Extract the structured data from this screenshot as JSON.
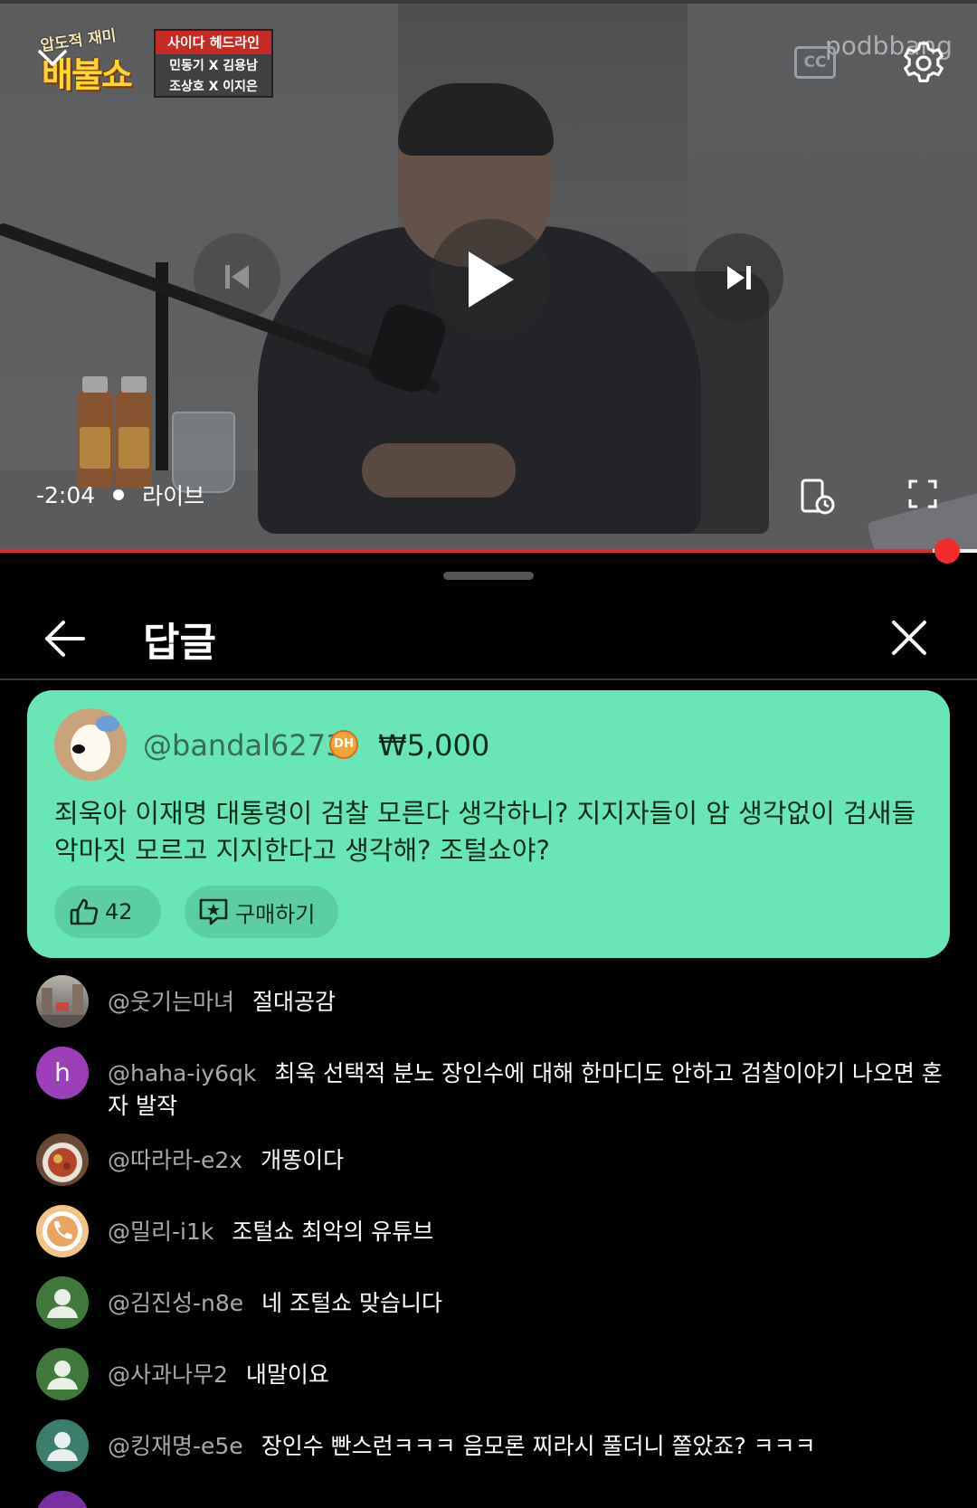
{
  "player": {
    "show_logo_tag": "압도적 재미",
    "show_logo_main": "배불쇼",
    "headline_title": "사이다 헤드라인",
    "headline_names_1": "민동기 X 김용남",
    "headline_names_2": "조상호 X 이지은",
    "cc_label": "CC",
    "watermark": "podbbang",
    "time_remaining": "-2:04",
    "live_label": "라이브",
    "progress": 0.955
  },
  "panel": {
    "title": "답글"
  },
  "super_chat": {
    "author": "@bandal6273",
    "badge": "DH",
    "amount": "₩5,000",
    "message": "죄욱아 이재명 대통령이 검찰 모른다 생각하니? 지지자들이 암 생각없이 검새들 악마짓 모르고 지지한다고 생각해? 조털쇼야?",
    "likes": "42",
    "buy_label": "구매하기",
    "color": "#69e6b6"
  },
  "comments": [
    {
      "author": "@웃기는마녀",
      "text": "절대공감",
      "avatar": "photo-street"
    },
    {
      "author": "@haha-iy6qk",
      "text": "최욱 선택적 분노 장인수에 대해 한마디도 안하고 검찰이야기 나오면 혼자 발작",
      "avatar": "letter",
      "letter": "h",
      "color": "#9c3fb8"
    },
    {
      "author": "@따라라-e2x",
      "text": "개똥이다",
      "avatar": "photo-food"
    },
    {
      "author": "@밀리-i1k",
      "text": "조털쇼 최악의 유튜브",
      "avatar": "phone-icon"
    },
    {
      "author": "@김진성-n8e",
      "text": "네 조털쇼 맞습니다",
      "avatar": "default-person",
      "color": "#3f7a3a"
    },
    {
      "author": "@사과나무2",
      "text": "내말이요",
      "avatar": "default-person",
      "color": "#3f7a3a"
    },
    {
      "author": "@킹재명-e5e",
      "text": "장인수 빤스런ㅋㅋㅋ 음모론 찌라시 풀더니 쫄았죠? ㅋㅋㅋ",
      "avatar": "default-person",
      "color": "#3a7f6e"
    }
  ]
}
